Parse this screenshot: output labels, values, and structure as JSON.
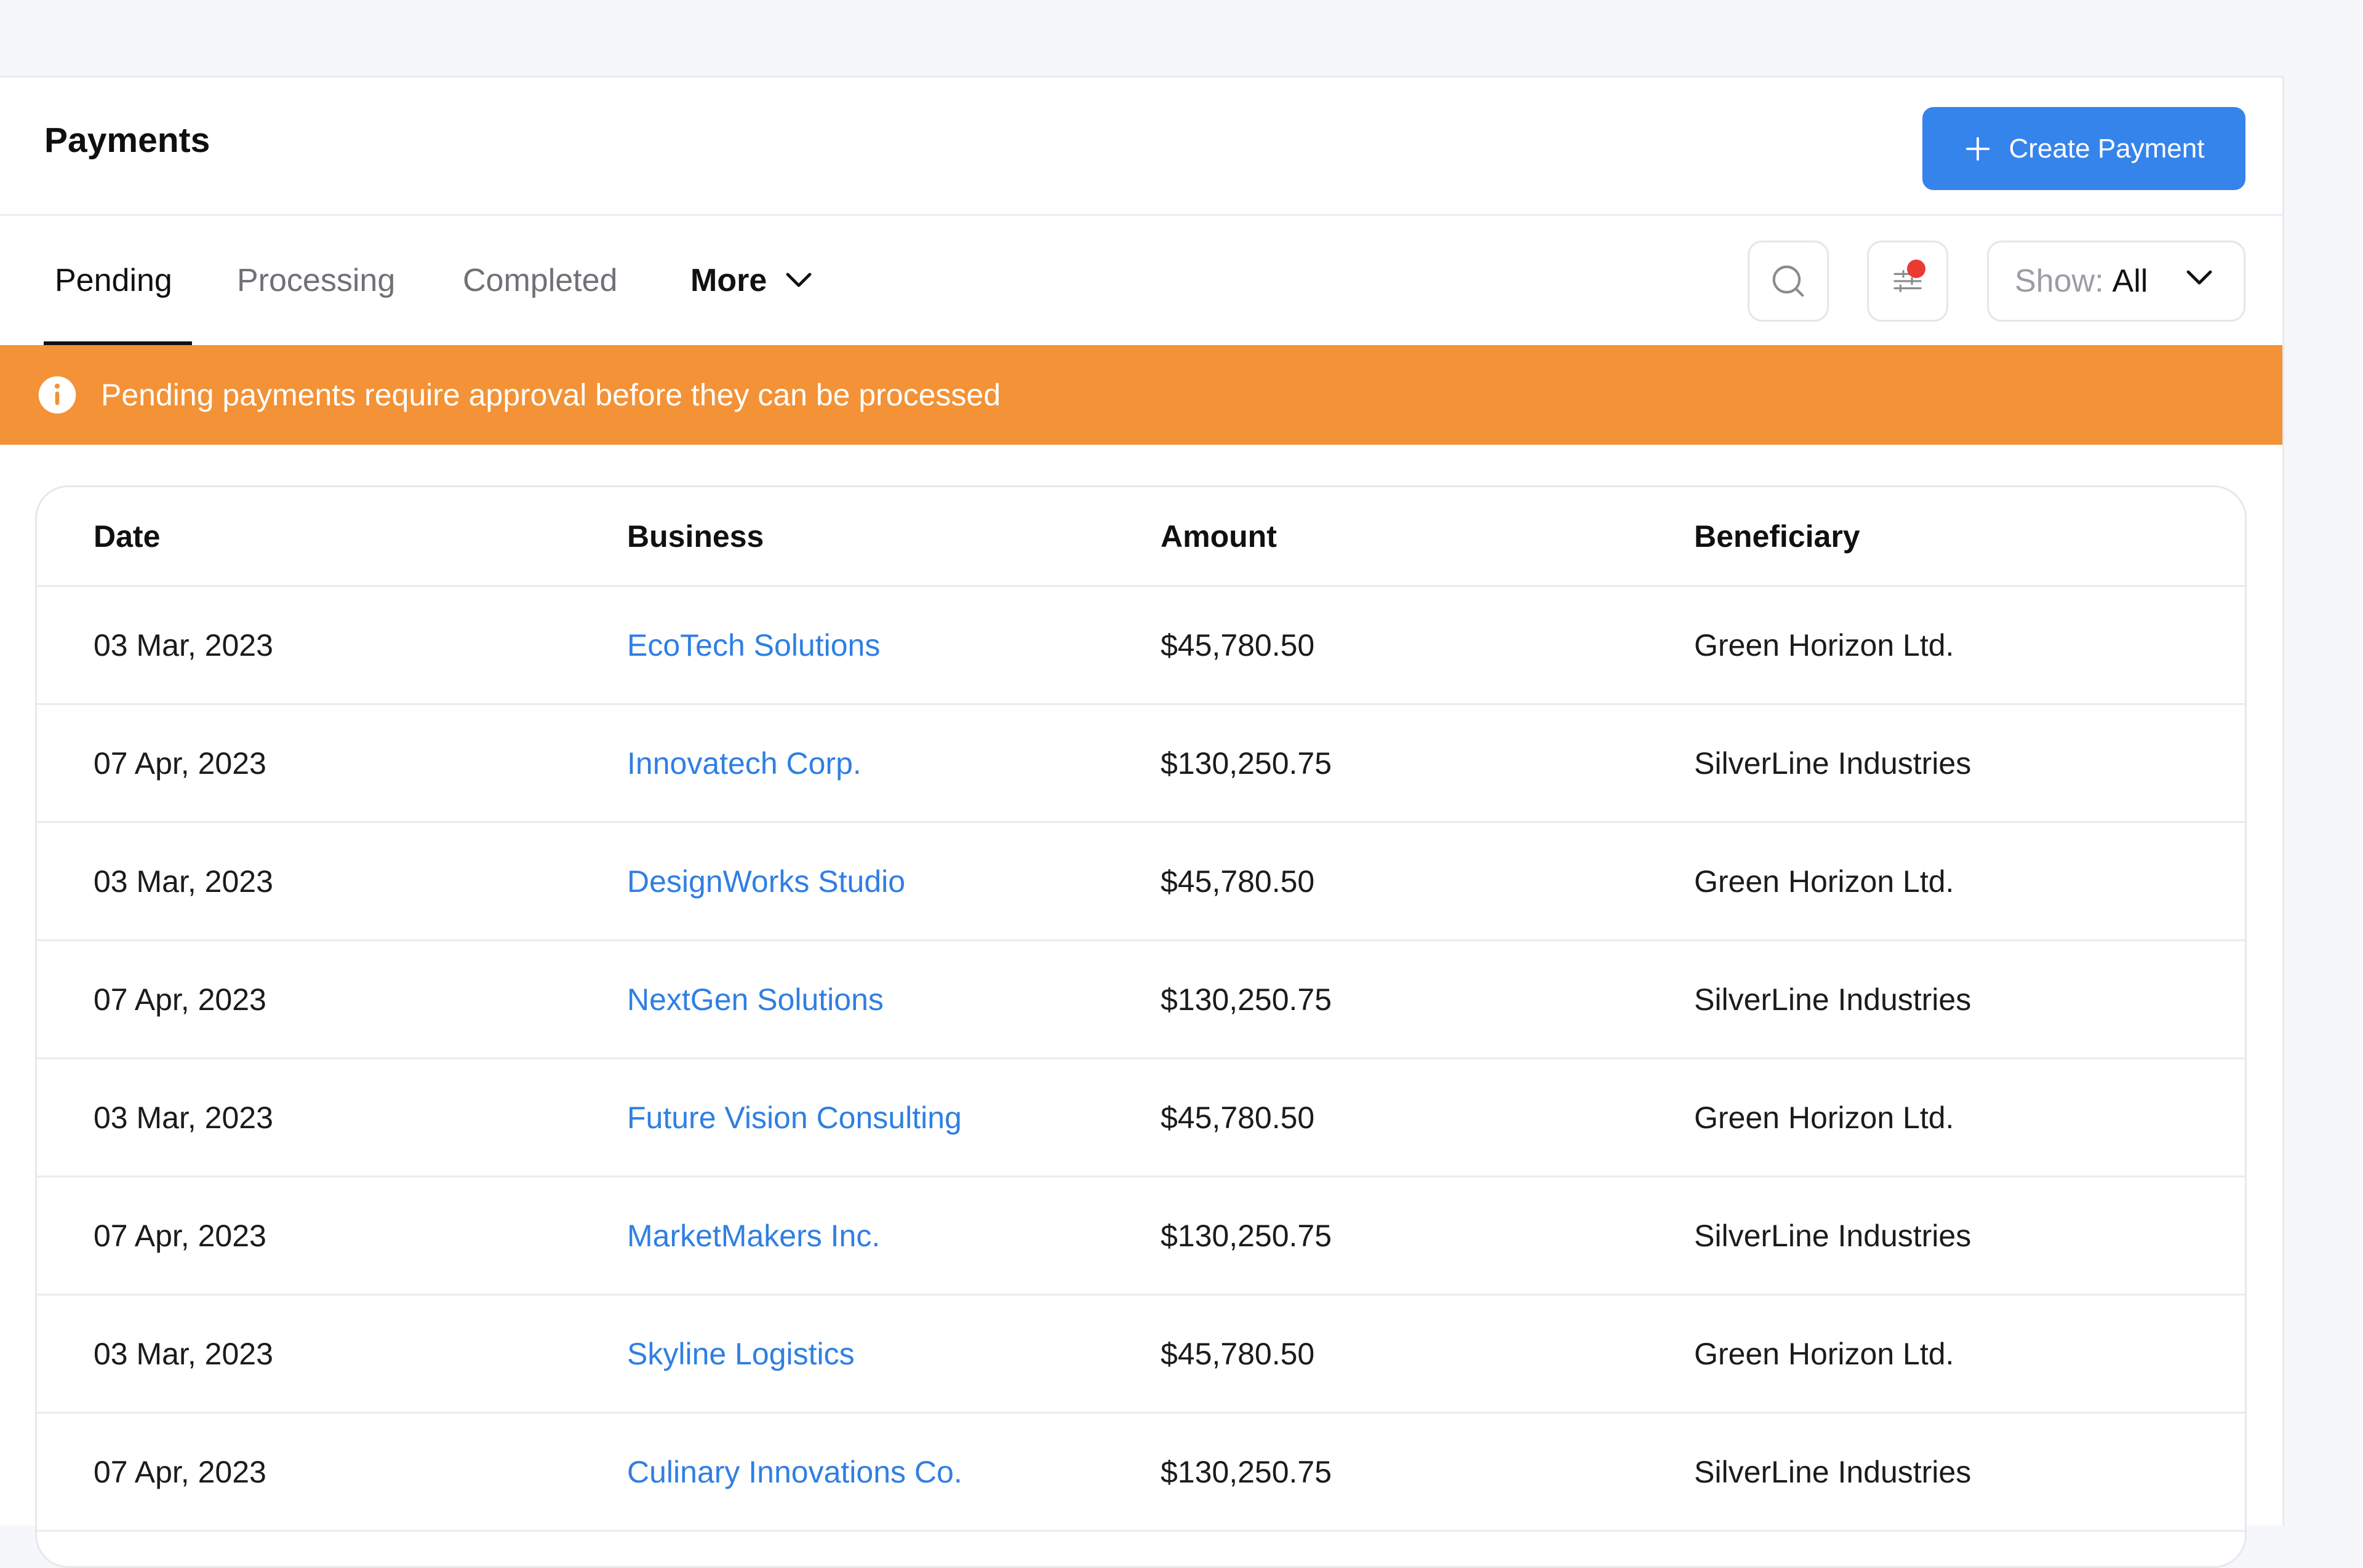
{
  "header": {
    "title": "Payments",
    "create_label": "Create Payment"
  },
  "tabs": [
    {
      "label": "Pending",
      "active": true
    },
    {
      "label": "Processing",
      "active": false
    },
    {
      "label": "Completed",
      "active": false
    },
    {
      "label": "More",
      "active": false
    }
  ],
  "toolbar": {
    "search_icon": "search-icon",
    "filter_icon": "filter-icon",
    "show_label": "Show:",
    "show_value": "All"
  },
  "banner": {
    "icon": "info-icon",
    "text": "Pending payments require approval before they can be processed",
    "color": "#f39236"
  },
  "table": {
    "columns": [
      "Date",
      "Business",
      "Amount",
      "Beneficiary"
    ],
    "rows": [
      {
        "date": "03 Mar, 2023",
        "business": "EcoTech Solutions",
        "amount": "$45,780.50",
        "beneficiary": "Green Horizon Ltd."
      },
      {
        "date": "07 Apr, 2023",
        "business": "Innovatech Corp.",
        "amount": "$130,250.75",
        "beneficiary": "SilverLine Industries"
      },
      {
        "date": "03 Mar, 2023",
        "business": "DesignWorks Studio",
        "amount": "$45,780.50",
        "beneficiary": "Green Horizon Ltd."
      },
      {
        "date": "07 Apr, 2023",
        "business": "NextGen Solutions",
        "amount": "$130,250.75",
        "beneficiary": "SilverLine Industries"
      },
      {
        "date": "03 Mar, 2023",
        "business": "Future Vision Consulting",
        "amount": "$45,780.50",
        "beneficiary": "Green Horizon Ltd."
      },
      {
        "date": "07 Apr, 2023",
        "business": "MarketMakers Inc.",
        "amount": "$130,250.75",
        "beneficiary": "SilverLine Industries"
      },
      {
        "date": "03 Mar, 2023",
        "business": "Skyline Logistics",
        "amount": "$45,780.50",
        "beneficiary": "Green Horizon Ltd."
      },
      {
        "date": "07 Apr, 2023",
        "business": "Culinary Innovations Co.",
        "amount": "$130,250.75",
        "beneficiary": "SilverLine Industries"
      }
    ]
  },
  "colors": {
    "accent": "#3584ec",
    "link": "#2f7fe3",
    "warning": "#f39236",
    "notification": "#ea3a32"
  }
}
